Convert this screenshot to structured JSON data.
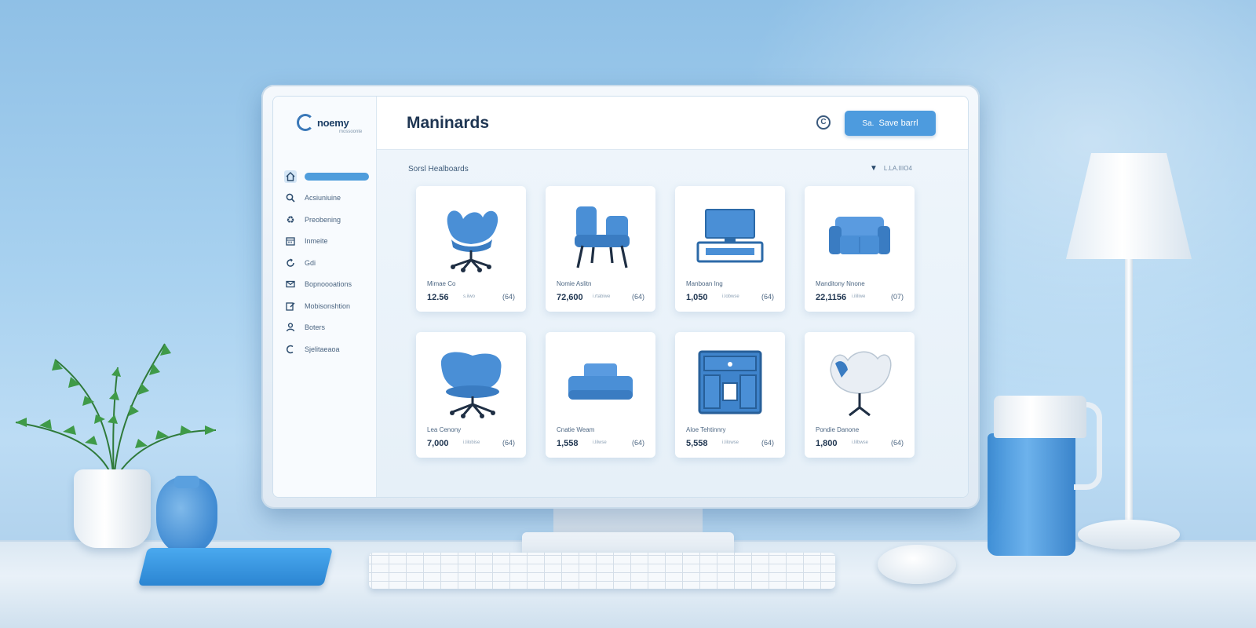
{
  "brand": {
    "name": "noemy",
    "tagline": "mossoonte"
  },
  "sidebar": {
    "items": [
      {
        "icon": "home-icon",
        "label": ""
      },
      {
        "icon": "search-icon",
        "label": "Acsiuniuine"
      },
      {
        "icon": "recycle-icon",
        "label": "Preobening"
      },
      {
        "icon": "calendar-icon",
        "label": "Inmeite"
      },
      {
        "icon": "refresh-icon",
        "label": "Gdi"
      },
      {
        "icon": "mail-icon",
        "label": "Bopnoooations"
      },
      {
        "icon": "edit-icon",
        "label": "Mobisonshtion"
      },
      {
        "icon": "user-icon",
        "label": "Boters"
      },
      {
        "icon": "loader-icon",
        "label": "Sjelitaeaoa"
      }
    ]
  },
  "header": {
    "title": "Maninards",
    "save_label": "Save barrl",
    "save_icon_text": "Sa.",
    "info_icon_text": "C"
  },
  "content": {
    "section_title": "Sorsl Healboards",
    "filter_label": "L.LA.IIIO4",
    "products": [
      {
        "name": "Mimae Co",
        "price": "12.56",
        "sub": "s.iiwo",
        "count": "(64)",
        "image": "swivel-chair"
      },
      {
        "name": "Nomie Aslitn",
        "price": "72,600",
        "sub": "i.rtabiwe",
        "count": "(64)",
        "image": "lounge-chair"
      },
      {
        "name": "Manboan Ing",
        "price": "1,050",
        "sub": "i.lobwse",
        "count": "(64)",
        "image": "tv-console"
      },
      {
        "name": "Manditony Nnone",
        "price": "22,1156",
        "sub": "i.ililiwe",
        "count": "(07)",
        "image": "sofa"
      },
      {
        "name": "Lea Cenony",
        "price": "7,000",
        "sub": "i.lilobise",
        "count": "(64)",
        "image": "tub-chair"
      },
      {
        "name": "Cnatie Weam",
        "price": "1,558",
        "sub": "i.lilwse",
        "count": "(64)",
        "image": "ottoman"
      },
      {
        "name": "Aloe Tehtinnry",
        "price": "5,558",
        "sub": "i.lilowse",
        "count": "(64)",
        "image": "cabinet"
      },
      {
        "name": "Pondie Danone",
        "price": "1,800",
        "sub": "i.lilbwse",
        "count": "(64)",
        "image": "shell-chair"
      }
    ]
  },
  "colors": {
    "accent": "#4d9bde",
    "chair": "#4a90d9",
    "title": "#1e3552"
  }
}
